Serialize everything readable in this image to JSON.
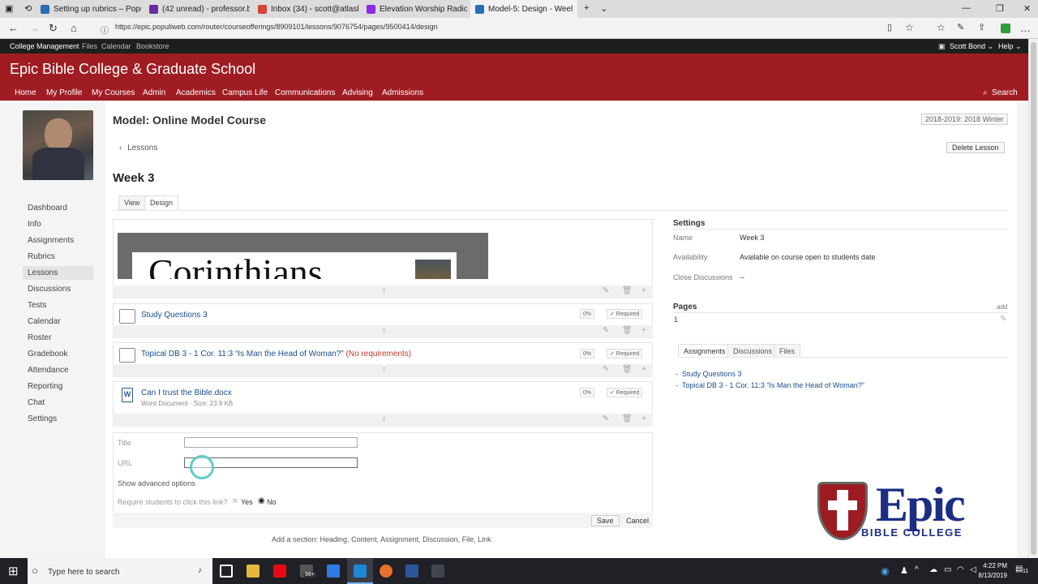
{
  "browser": {
    "tabs": [
      {
        "title": "Setting up rubrics – Populi K",
        "color": "#2c6db5"
      },
      {
        "title": "(42 unread) - professor.bonc",
        "color": "#6a2ca0"
      },
      {
        "title": "Inbox (34) - scott@atlasbibl",
        "color": "#d44638"
      },
      {
        "title": "Elevation Worship Radio – N",
        "color": "#8a2be2"
      },
      {
        "title": "Model-5: Design - Weel",
        "color": "#2c6db5"
      }
    ],
    "url": "https://epic.populiweb.com/router/courseofferings/8909101/lessons/9076754/pages/9500414/design"
  },
  "topstrip": {
    "left": [
      "College Management",
      "Files",
      "Calendar",
      "Bookstore"
    ],
    "user": "Scott Bond ⌄",
    "help": "Help ⌄"
  },
  "site": {
    "title": "Epic Bible College & Graduate School",
    "nav": [
      "Home",
      "My Profile",
      "My Courses",
      "Admin",
      "Academics",
      "Campus Life",
      "Communications",
      "Advising",
      "Admissions"
    ],
    "search": "Search"
  },
  "sidebar": [
    "Dashboard",
    "Info",
    "Assignments",
    "Rubrics",
    "Lessons",
    "Discussions",
    "Tests",
    "Calendar",
    "Roster",
    "Gradebook",
    "Attendance",
    "Reporting",
    "Chat",
    "Settings"
  ],
  "course": {
    "title": "Model: Online Model Course",
    "term": "2018-2019: 2018 Winter",
    "back": "Lessons",
    "delete": "Delete Lesson",
    "lesson": "Week 3",
    "tab_view": "View",
    "tab_design": "Design"
  },
  "content": {
    "image_word": "Corinthians",
    "items": [
      {
        "title": "Study Questions 3",
        "pct": "0%",
        "req": "✓ Required",
        "extra": ""
      },
      {
        "title": "Topical DB 3 - 1 Cor. 11:3 “Is Man the Head of Woman?”",
        "pct": "0%",
        "req": "✓ Required",
        "extra": "(No requirements)"
      },
      {
        "title": "Can I trust the Bible.docx",
        "sub": "Word Document  ·  Size: 23.9 KB",
        "pct": "0%",
        "req": "✓ Required"
      }
    ],
    "form": {
      "title_label": "Title",
      "url_label": "URL",
      "advanced": "Show advanced options",
      "require": "Require students to click this link?",
      "yes": "Yes",
      "no": "No",
      "save": "Save",
      "cancel": "Cancel"
    },
    "add_section": "Add a section:  Heading, Content, Assignment, Discussion, File, Link"
  },
  "settings": {
    "title": "Settings",
    "name_label": "Name",
    "name": "Week 3",
    "avail_label": "Availability",
    "avail": "Available on course open to students date",
    "close_label": "Close Discussions",
    "close": "--",
    "pages_title": "Pages",
    "add": "add",
    "page": "1",
    "tabs": [
      "Assignments",
      "Discussions",
      "Files"
    ],
    "links": [
      "Study Questions 3",
      "Topical DB 3 - 1 Cor. 11:3 “Is Man the Head of Woman?”"
    ]
  },
  "logo": {
    "big": "Epic",
    "small": "BIBLE COLLEGE"
  },
  "taskbar": {
    "search": "Type here to search",
    "badge": "99+",
    "time": "4:22 PM",
    "date": "8/13/2019",
    "notif": "11"
  }
}
